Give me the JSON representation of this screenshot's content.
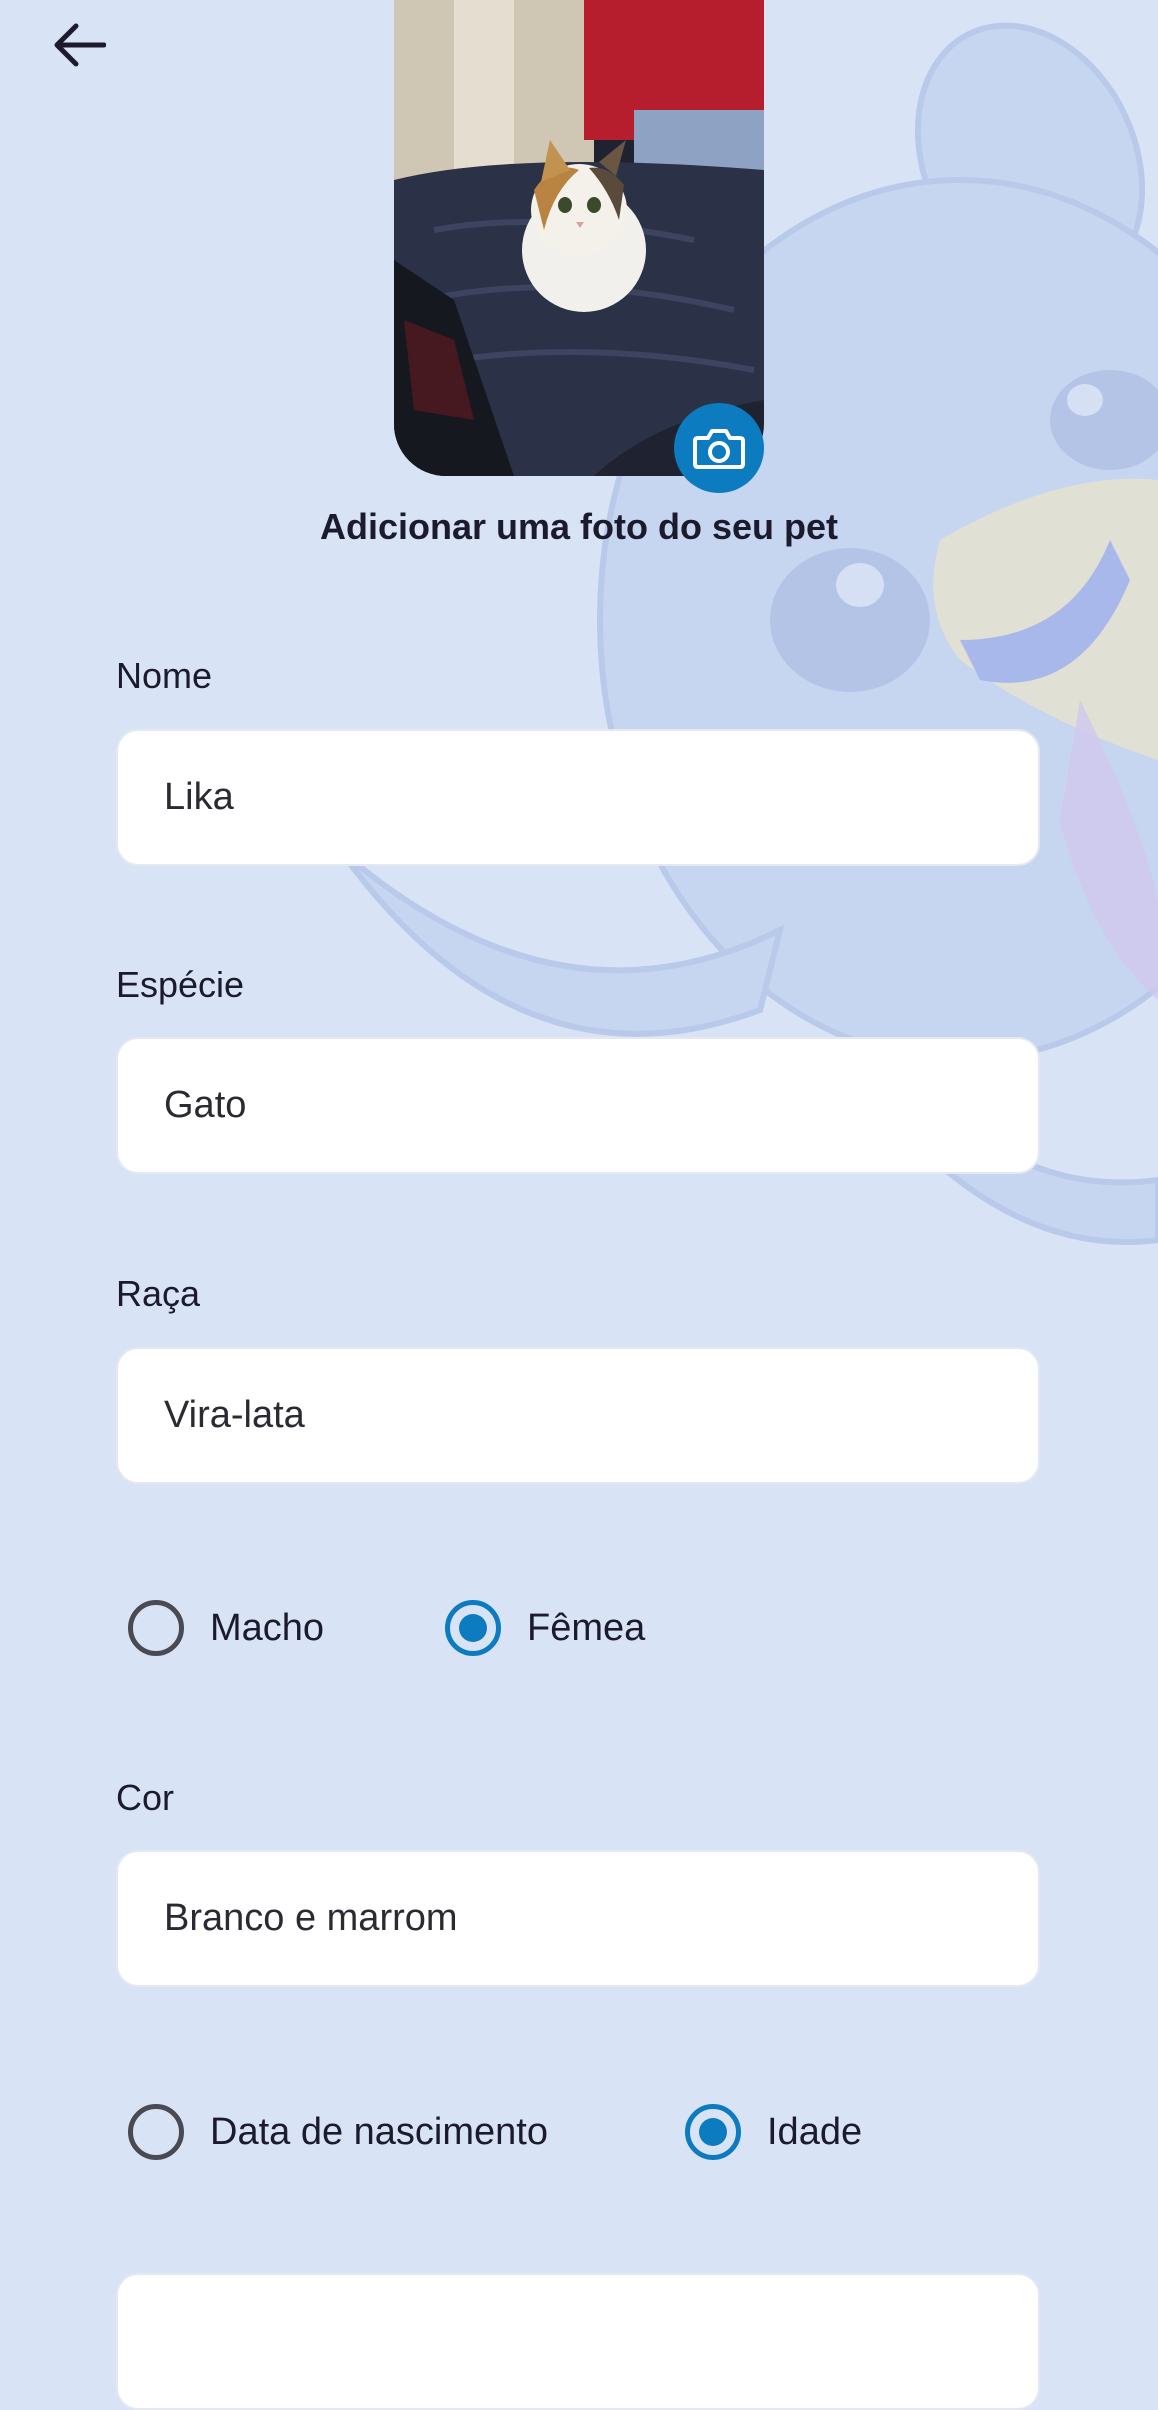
{
  "header": {
    "back_icon": "arrow-left-icon"
  },
  "photo": {
    "caption": "Adicionar uma foto do seu pet",
    "camera_icon": "camera-icon",
    "accent": "#0c7bc0"
  },
  "form": {
    "name": {
      "label": "Nome",
      "value": "Lika"
    },
    "species": {
      "label": "Espécie",
      "value": "Gato"
    },
    "breed": {
      "label": "Raça",
      "value": "Vira-lata"
    },
    "sex": {
      "options": [
        {
          "label": "Macho",
          "selected": false
        },
        {
          "label": "Fêmea",
          "selected": true
        }
      ]
    },
    "color": {
      "label": "Cor",
      "value": "Branco e marrom"
    },
    "age_mode": {
      "options": [
        {
          "label": "Data de nascimento",
          "selected": false
        },
        {
          "label": "Idade",
          "selected": true
        }
      ]
    },
    "age": {
      "value": ""
    }
  },
  "colors": {
    "background": "#d9e3f6",
    "accent": "#0c7bc0",
    "text": "#1c1b2e"
  }
}
